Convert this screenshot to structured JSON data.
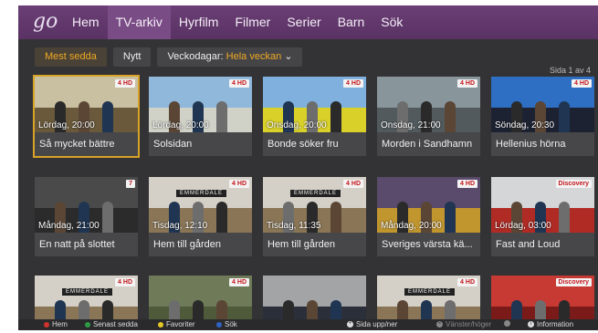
{
  "header": {
    "logo": "go",
    "nav": [
      "Hem",
      "TV-arkiv",
      "Hyrfilm",
      "Filmer",
      "Serier",
      "Barn",
      "Sök"
    ],
    "active_index": 1
  },
  "filters": {
    "most_watched": "Mest sedda",
    "new": "Nytt",
    "weekdays_label": "Veckodagar:",
    "weekdays_value": "Hela veckan",
    "chevron": "⌄"
  },
  "pager": "Sida 1 av 4",
  "tiles": [
    {
      "title": "Så mycket bättre",
      "time": "Lördag, 20:00",
      "channel": "4 HD",
      "sky": "#c9c0a2",
      "ground": "#6a5a3b",
      "selected": true
    },
    {
      "title": "Solsidan",
      "time": "Lördag, 20:00",
      "channel": "4 HD",
      "sky": "#8fb8da",
      "ground": "#d0d2c8"
    },
    {
      "title": "Bonde söker fru",
      "time": "Onsdag, 20:00",
      "channel": "4 HD",
      "sky": "#7fb0de",
      "ground": "#d9d12a"
    },
    {
      "title": "Morden i Sandhamn",
      "time": "Onsdag, 21:00",
      "channel": "4 HD",
      "sky": "#88969c",
      "ground": "#525a5e"
    },
    {
      "title": "Hellenius hörna",
      "time": "Söndag, 20:30",
      "channel": "4 HD",
      "sky": "#2f6fc3",
      "ground": "#1d2233"
    },
    {
      "title": "En natt på slottet",
      "time": "Måndag, 21:00",
      "channel": "7",
      "sky": "#4a4a4a",
      "ground": "#2b2b2b"
    },
    {
      "title": "Hem till gården",
      "time": "Tisdag, 12:10",
      "channel": "4 HD",
      "sky": "#d5d0c7",
      "ground": "#8a7656",
      "emmerdale": "EMMERDALE"
    },
    {
      "title": "Hem till gården",
      "time": "Tisdag, 11:35",
      "channel": "4 HD",
      "sky": "#d5d0c7",
      "ground": "#8a7656",
      "emmerdale": "EMMERDALE"
    },
    {
      "title": "Sveriges värsta kä...",
      "time": "Måndag, 20:00",
      "channel": "4 HD",
      "sky": "#5a4a6b",
      "ground": "#c1962f"
    },
    {
      "title": "Fast and Loud",
      "time": "Lördag, 03:00",
      "channel": "Discovery",
      "sky": "#d4d6d8",
      "ground": "#b12b25"
    },
    {
      "title": "",
      "time": "",
      "channel": "4 HD",
      "sky": "#d5d0c7",
      "ground": "#8a7656",
      "emmerdale": "EMMERDALE"
    },
    {
      "title": "",
      "time": "",
      "channel": "4 HD",
      "sky": "#6e7a58",
      "ground": "#4e5a3a"
    },
    {
      "title": "",
      "time": "",
      "channel": "",
      "sky": "#a2a4a6",
      "ground": "#2b2f3a"
    },
    {
      "title": "",
      "time": "",
      "channel": "4 HD",
      "sky": "#d5d0c7",
      "ground": "#8a7656",
      "emmerdale": "EMMERDALE"
    },
    {
      "title": "",
      "time": "",
      "channel": "Discovery",
      "sky": "#c63a33",
      "ground": "#7a1b19"
    }
  ],
  "footer": {
    "items": [
      {
        "label": "Hem",
        "color": "#d0342c"
      },
      {
        "label": "Senast sedda",
        "color": "#2e9c47"
      },
      {
        "label": "Favoriter",
        "color": "#e6c824"
      },
      {
        "label": "Sök",
        "color": "#2f63c4"
      }
    ],
    "page_nav": "Sida upp/ner",
    "lr": "Vänster/höger",
    "info": "Information"
  }
}
